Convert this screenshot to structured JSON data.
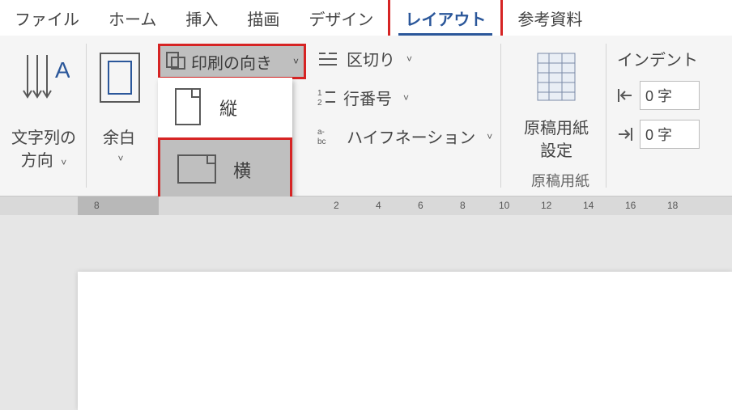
{
  "tabs": {
    "file": "ファイル",
    "home": "ホーム",
    "insert": "挿入",
    "draw": "描画",
    "design": "デザイン",
    "layout": "レイアウト",
    "references": "参考資料"
  },
  "ribbon": {
    "textDirection": {
      "label1": "文字列の",
      "label2": "方向",
      "chev": "˅"
    },
    "margins": {
      "label": "余白",
      "chev": "˅"
    },
    "orientation": {
      "button": "印刷の向き",
      "chev": "˅",
      "portrait": "縦",
      "landscape": "横"
    },
    "breaks": {
      "label": "区切り",
      "chev": "˅"
    },
    "lineNumbers": {
      "label": "行番号",
      "chev": "˅"
    },
    "hyphenation": {
      "label": "ハイフネーション",
      "chev": "˅"
    },
    "manuscript": {
      "label1": "原稿用紙",
      "label2": "設定",
      "group": "原稿用紙"
    },
    "indent": {
      "title": "インデント",
      "left": "0 字",
      "right": "0 字"
    }
  },
  "ruler": {
    "marks": [
      "8",
      "2",
      "4",
      "6",
      "8",
      "10",
      "12",
      "14",
      "16",
      "18"
    ]
  }
}
